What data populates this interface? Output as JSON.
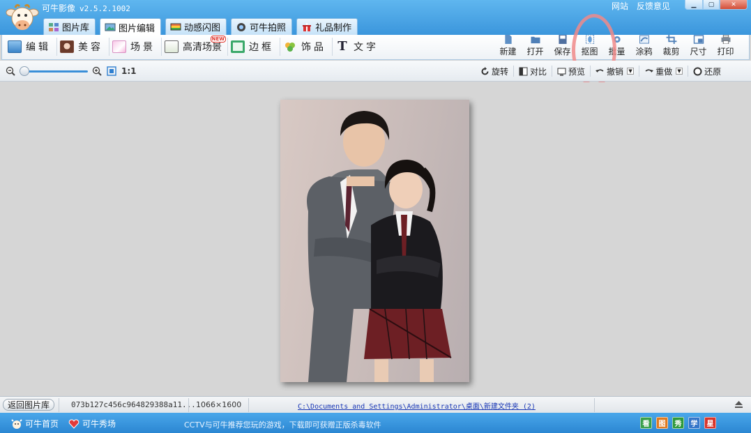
{
  "window": {
    "app_name": "可牛影像",
    "version": "v2.5.2.1002",
    "links": [
      "网站",
      "反馈意见"
    ]
  },
  "tabs": [
    {
      "label": "图片库",
      "icon": "photo-library-icon"
    },
    {
      "label": "图片编辑",
      "icon": "photo-edit-icon",
      "active": true
    },
    {
      "label": "动感闪图",
      "icon": "flash-image-icon"
    },
    {
      "label": "可牛拍照",
      "icon": "camera-icon"
    },
    {
      "label": "礼品制作",
      "icon": "gift-icon"
    }
  ],
  "toolbar_left": [
    {
      "label": "编辑",
      "icon": "edit-icon"
    },
    {
      "label": "美容",
      "icon": "beauty-icon"
    },
    {
      "label": "场景",
      "icon": "scene-icon"
    },
    {
      "label": "高清场景",
      "icon": "hd-scene-icon",
      "badge": "NEW"
    },
    {
      "label": "边框",
      "icon": "border-icon"
    },
    {
      "label": "饰品",
      "icon": "accessory-icon"
    },
    {
      "label": "文字",
      "icon": "text-icon"
    }
  ],
  "toolbar_right": [
    {
      "label": "新建",
      "icon": "new-file-icon"
    },
    {
      "label": "打开",
      "icon": "open-folder-icon"
    },
    {
      "label": "保存",
      "icon": "save-icon"
    },
    {
      "label": "抠图",
      "icon": "cutout-icon"
    },
    {
      "label": "批量",
      "icon": "batch-gear-icon"
    },
    {
      "label": "涂鸦",
      "icon": "doodle-icon"
    },
    {
      "label": "裁剪",
      "icon": "crop-icon"
    },
    {
      "label": "尺寸",
      "icon": "resize-icon"
    },
    {
      "label": "打印",
      "icon": "print-icon"
    }
  ],
  "subbar": {
    "zoom_label": "1:1",
    "actions": [
      {
        "label": "旋转",
        "icon": "rotate-icon"
      },
      {
        "label": "对比",
        "icon": "compare-icon"
      },
      {
        "label": "预览",
        "icon": "preview-icon"
      },
      {
        "label": "撤销",
        "icon": "undo-icon",
        "dropdown": true
      },
      {
        "label": "重做",
        "icon": "redo-icon",
        "dropdown": true
      },
      {
        "label": "还原",
        "icon": "restore-icon"
      }
    ]
  },
  "status": {
    "back_label": "返回图片库",
    "file_name": "073b127c456c964829388a11...",
    "dimensions": "1066×1600",
    "path": "C:\\Documents and Settings\\Administrator\\桌面\\新建文件夹 (2)"
  },
  "bottom": {
    "home_label": "可牛首页",
    "show_label": "可牛秀场",
    "ticker": "CCTV与可牛推荐您玩的游戏，下载即可获赠正版杀毒软件",
    "icons": [
      {
        "glyph": "看",
        "color": "#3aa04a"
      },
      {
        "glyph": "图",
        "color": "#e07a1f"
      },
      {
        "glyph": "秀",
        "color": "#2f9a3c"
      },
      {
        "glyph": "学",
        "color": "#3576c9"
      },
      {
        "glyph": "星",
        "color": "#d8352b"
      }
    ]
  }
}
